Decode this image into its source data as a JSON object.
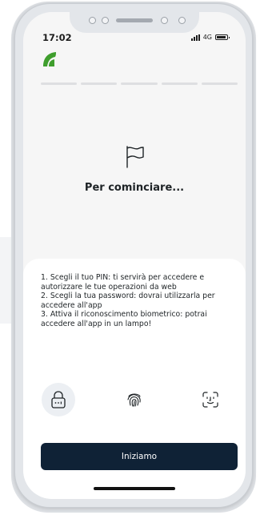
{
  "status_bar": {
    "time": "17:02",
    "network": "4G"
  },
  "header": {
    "logo": "brand-leaf-logo"
  },
  "progress": {
    "total_steps": 5,
    "current_step": 0
  },
  "intro": {
    "icon": "flag-icon",
    "title": "Per cominciare..."
  },
  "steps": [
    "1. Scegli il tuo PIN: ti servirà per accedere e autorizzare le tue operazioni da web",
    "2. Scegli la tua password: dovrai utilizzarla per accedere all'app",
    "3. Attiva il riconoscimento biometrico: potrai accedere all'app in un lampo!"
  ],
  "methods": [
    {
      "icon": "lock-icon",
      "active": true
    },
    {
      "icon": "fingerprint-icon",
      "active": false
    },
    {
      "icon": "face-id-icon",
      "active": false
    }
  ],
  "cta": {
    "label": "Iniziamo"
  },
  "colors": {
    "brand_green": "#3f9e2d",
    "button_bg": "#0f2236",
    "screen_bg": "#f6f6f6"
  }
}
